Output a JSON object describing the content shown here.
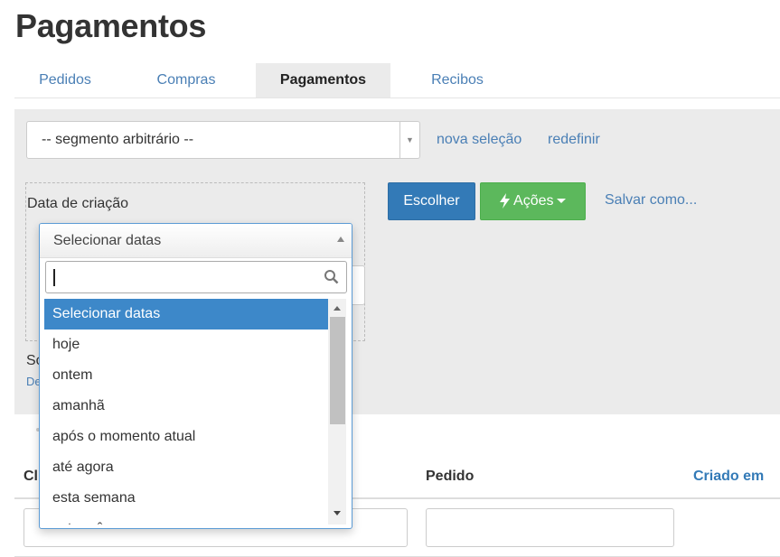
{
  "page": {
    "title": "Pagamentos"
  },
  "tabs": [
    {
      "label": "Pedidos"
    },
    {
      "label": "Compras"
    },
    {
      "label": "Pagamentos"
    },
    {
      "label": "Recibos"
    }
  ],
  "filter": {
    "segment_value": "-- segmento arbitrário --",
    "new_selection": "nova seleção",
    "reset": "redefinir",
    "criteria_label": "Data de criação",
    "choose": "Escolher",
    "actions": "Ações",
    "save_as": "Salvar como...",
    "partial_text_1": "So",
    "partial_text_2": "De"
  },
  "dropdown": {
    "selected_value": "Selecionar datas",
    "search_value": "",
    "options": [
      "Selecionar datas",
      "hoje",
      "ontem",
      "amanhã",
      "após o momento atual",
      "até agora",
      "esta semana",
      "este mês"
    ]
  },
  "table": {
    "columns": [
      "Cl",
      "Pedido",
      "Criado em"
    ]
  },
  "colors": {
    "primary": "#337ab7",
    "success": "#5cb85c",
    "link": "#4a7fb5",
    "selected": "#3d88c9"
  },
  "icons": {
    "search": "magnifier",
    "actions": "lightning-bolt"
  }
}
